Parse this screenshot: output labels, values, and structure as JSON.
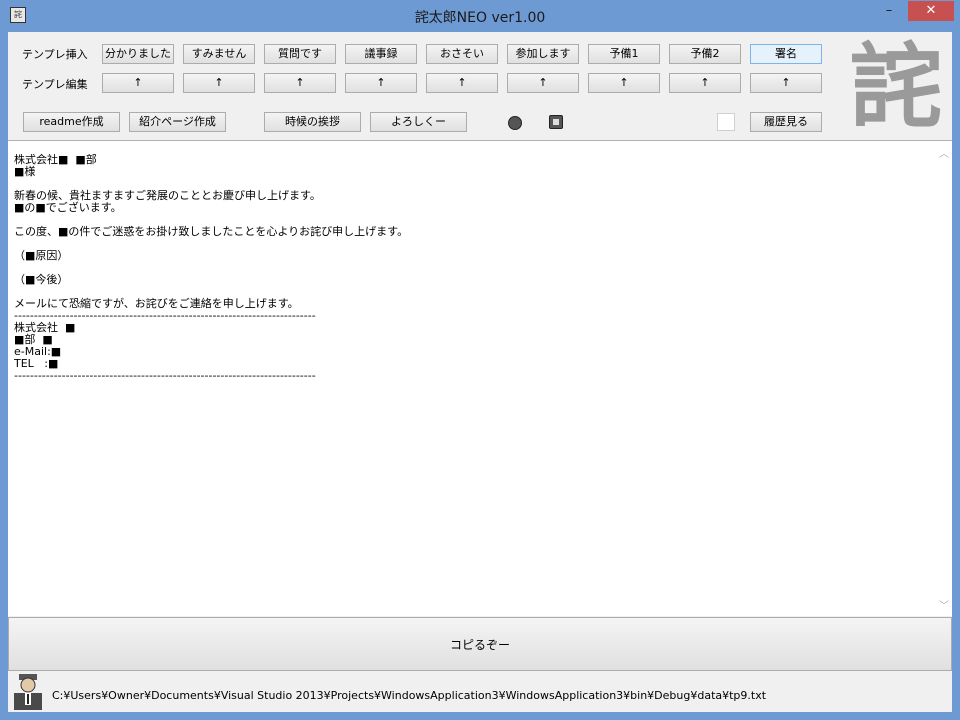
{
  "window": {
    "title": "詫太郎NEO  ver1.00",
    "app_icon": "詫",
    "controls": {
      "minimize": "–",
      "maximize": "□",
      "close": "✕"
    }
  },
  "row_labels": {
    "insert": "テンプレ挿入",
    "edit": "テンプレ編集"
  },
  "template_buttons": [
    "分かりました",
    "すみません",
    "質問です",
    "議事録",
    "おさそい",
    "参加します",
    "予備1",
    "予備2",
    "署名"
  ],
  "edit_button_label": "↑",
  "tools": {
    "readme": "readme作成",
    "intro": "紹介ページ作成",
    "season": "時候の挨拶",
    "regards": "よろしくー",
    "history": "履歴見る"
  },
  "logo_text": "詫",
  "editor": {
    "text": "株式会社■  ■部\n■様\n\n新春の候、貴社ますますご発展のこととお慶び申し上げます。\n■の■でございます。\n\nこの度、■の件でご迷惑をお掛け致しましたことを心よりお詫び申し上げます。\n\n（■原因）\n\n（■今後）\n\nメールにて恐縮ですが、お詫びをご連絡を申し上げます。\n----------------------------------------------------------------------------\n株式会社  ■\n■部  ■\ne-Mail:■\nTEL   :■\n----------------------------------------------------------------------------",
    "scroll_up": "︿",
    "scroll_down": "﹀"
  },
  "copy_button": "コピるぞー",
  "status": {
    "path": "C:¥Users¥Owner¥Documents¥Visual Studio 2013¥Projects¥WindowsApplication3¥WindowsApplication3¥bin¥Debug¥data¥tp9.txt"
  }
}
